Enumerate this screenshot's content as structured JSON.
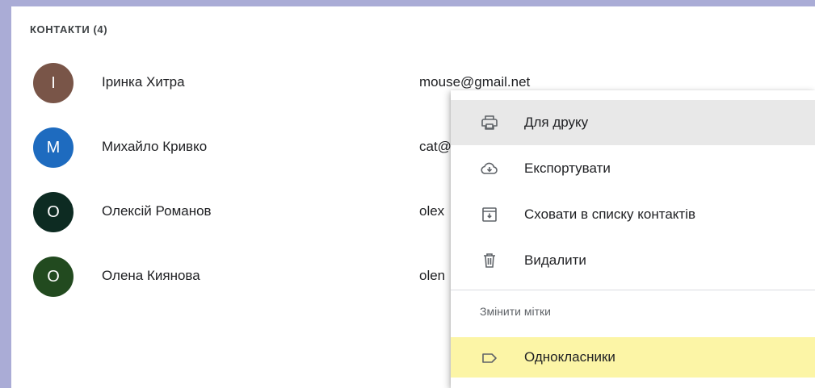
{
  "section": {
    "title": "КОНТАКТИ (4)"
  },
  "contacts": [
    {
      "initial": "І",
      "name": "Іринка Хитра",
      "email": "mouse@gmail.net",
      "color": "#795548"
    },
    {
      "initial": "M",
      "name": "Михайло Кривко",
      "email": "cat@",
      "color": "#1e6bbf"
    },
    {
      "initial": "O",
      "name": "Олексій Романов",
      "email": "olex",
      "color": "#0d2b22"
    },
    {
      "initial": "O",
      "name": "Олена Киянова",
      "email": "olen",
      "color": "#224a1f"
    }
  ],
  "menu": {
    "items": [
      {
        "label": "Для друку",
        "icon": "print-icon"
      },
      {
        "label": "Експортувати",
        "icon": "cloud-download-icon"
      },
      {
        "label": "Сховати в списку контактів",
        "icon": "archive-icon"
      },
      {
        "label": "Видалити",
        "icon": "trash-icon"
      }
    ],
    "labels_heading": "Змінити мітки",
    "labels": [
      {
        "label": "Однокласники",
        "icon": "label-icon"
      }
    ]
  },
  "colors": {
    "background": "#aaacd6",
    "hover": "#e8e8e8",
    "label_highlight": "#fcf5a6"
  }
}
